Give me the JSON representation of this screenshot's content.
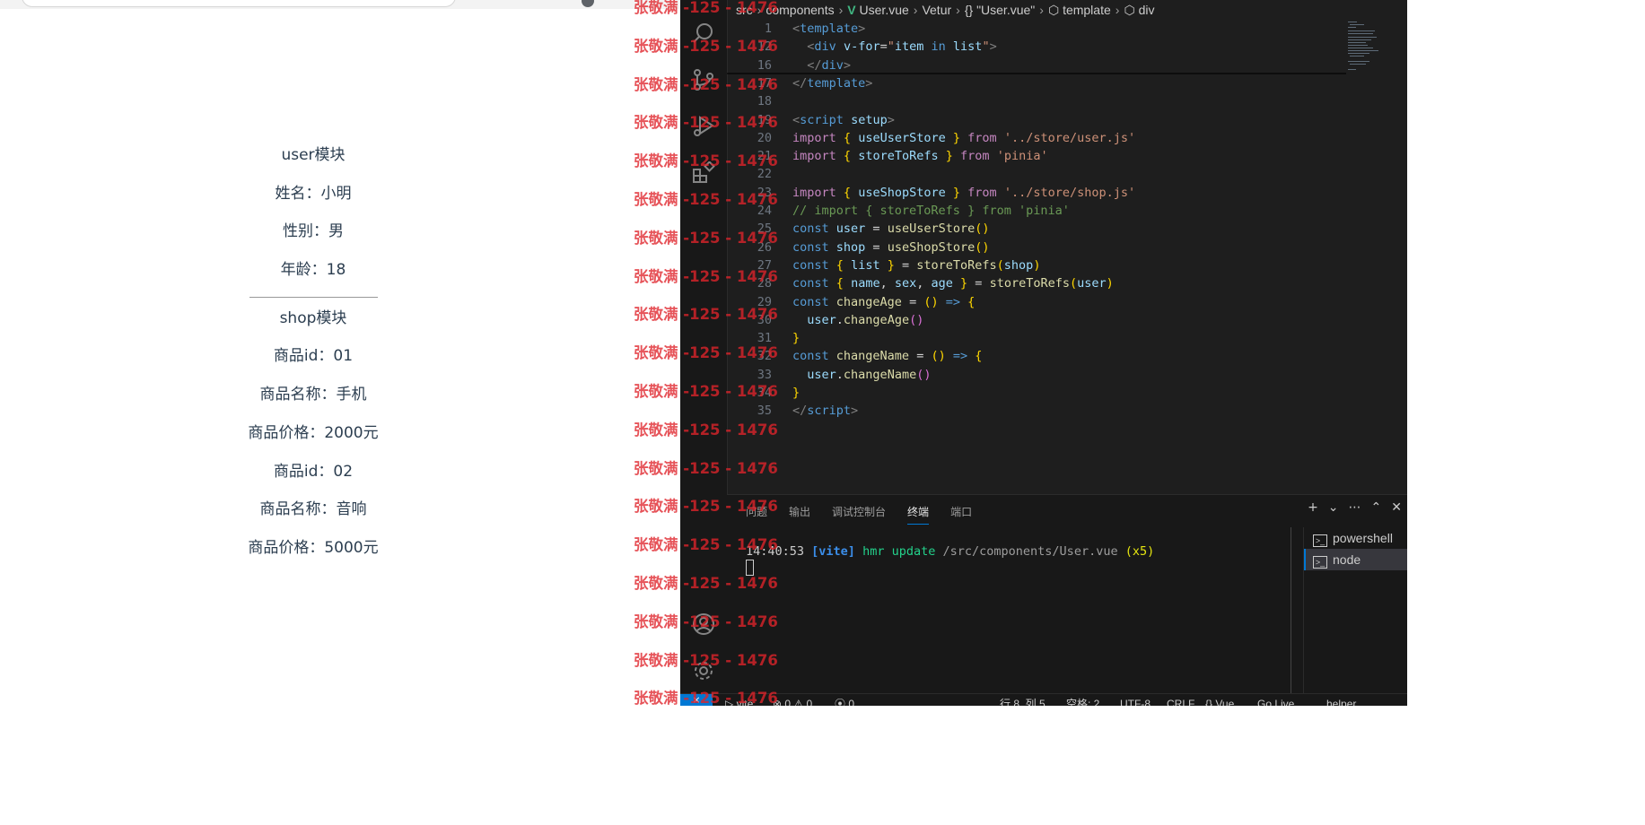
{
  "browser": {
    "sections": [
      {
        "title": "user模块",
        "lines": [
          "姓名：小明",
          "性别：男",
          "年龄：18"
        ]
      },
      {
        "title": "shop模块",
        "lines": [
          "商品id：01",
          "商品名称：手机",
          "商品价格：2000元",
          "商品id：02",
          "商品名称：音响",
          "商品价格：5000元"
        ]
      }
    ]
  },
  "vscode": {
    "breadcrumb": [
      "src",
      "components",
      "User.vue",
      "Vetur",
      "{} \"User.vue\"",
      "template",
      "div"
    ],
    "activity_icons": [
      "search-icon",
      "source-control-icon",
      "run-debug-icon",
      "extensions-icon",
      "account-icon",
      "settings-gear-icon"
    ],
    "code_lines": [
      {
        "n": "1",
        "tokens": [
          [
            "t-tag",
            "<"
          ],
          [
            "t-name",
            "template"
          ],
          [
            "t-tag",
            ">"
          ]
        ]
      },
      {
        "n": "12",
        "tokens": [
          [
            "t-op",
            "  "
          ],
          [
            "t-tag",
            "<"
          ],
          [
            "t-name",
            "div"
          ],
          [
            "t-op",
            " "
          ],
          [
            "t-attr",
            "v-for"
          ],
          [
            "t-op",
            "="
          ],
          [
            "t-str",
            "\""
          ],
          [
            "t-var",
            "item"
          ],
          [
            "t-op",
            " "
          ],
          [
            "t-const",
            "in"
          ],
          [
            "t-op",
            " "
          ],
          [
            "t-var",
            "list"
          ],
          [
            "t-str",
            "\""
          ],
          [
            "t-tag",
            ">"
          ]
        ]
      },
      {
        "n": "16",
        "tokens": [
          [
            "t-op",
            "  "
          ],
          [
            "t-tag",
            "</"
          ],
          [
            "t-name",
            "div"
          ],
          [
            "t-tag",
            ">"
          ]
        ]
      },
      {
        "n": "17",
        "tokens": [
          [
            "t-tag",
            "</"
          ],
          [
            "t-name",
            "template"
          ],
          [
            "t-tag",
            ">"
          ]
        ]
      },
      {
        "n": "18",
        "tokens": []
      },
      {
        "n": "19",
        "tokens": [
          [
            "t-tag",
            "<"
          ],
          [
            "t-name",
            "script"
          ],
          [
            "t-op",
            " "
          ],
          [
            "t-attr",
            "setup"
          ],
          [
            "t-tag",
            ">"
          ]
        ]
      },
      {
        "n": "20",
        "tokens": [
          [
            "t-kw",
            "import"
          ],
          [
            "t-op",
            " "
          ],
          [
            "t-b1",
            "{"
          ],
          [
            "t-op",
            " "
          ],
          [
            "t-var",
            "useUserStore"
          ],
          [
            "t-op",
            " "
          ],
          [
            "t-b1",
            "}"
          ],
          [
            "t-op",
            " "
          ],
          [
            "t-kw",
            "from"
          ],
          [
            "t-op",
            " "
          ],
          [
            "t-str",
            "'../store/user.js'"
          ]
        ]
      },
      {
        "n": "21",
        "tokens": [
          [
            "t-kw",
            "import"
          ],
          [
            "t-op",
            " "
          ],
          [
            "t-b1",
            "{"
          ],
          [
            "t-op",
            " "
          ],
          [
            "t-var",
            "storeToRefs"
          ],
          [
            "t-op",
            " "
          ],
          [
            "t-b1",
            "}"
          ],
          [
            "t-op",
            " "
          ],
          [
            "t-kw",
            "from"
          ],
          [
            "t-op",
            " "
          ],
          [
            "t-str",
            "'pinia'"
          ]
        ]
      },
      {
        "n": "22",
        "tokens": []
      },
      {
        "n": "23",
        "tokens": [
          [
            "t-kw",
            "import"
          ],
          [
            "t-op",
            " "
          ],
          [
            "t-b1",
            "{"
          ],
          [
            "t-op",
            " "
          ],
          [
            "t-var",
            "useShopStore"
          ],
          [
            "t-op",
            " "
          ],
          [
            "t-b1",
            "}"
          ],
          [
            "t-op",
            " "
          ],
          [
            "t-kw",
            "from"
          ],
          [
            "t-op",
            " "
          ],
          [
            "t-str",
            "'../store/shop.js'"
          ]
        ]
      },
      {
        "n": "24",
        "tokens": [
          [
            "t-cm",
            "// import { storeToRefs } from 'pinia'"
          ]
        ]
      },
      {
        "n": "25",
        "tokens": [
          [
            "t-const",
            "const"
          ],
          [
            "t-op",
            " "
          ],
          [
            "t-var",
            "user"
          ],
          [
            "t-op",
            " = "
          ],
          [
            "t-fn",
            "useUserStore"
          ],
          [
            "t-b1",
            "()"
          ]
        ]
      },
      {
        "n": "26",
        "tokens": [
          [
            "t-const",
            "const"
          ],
          [
            "t-op",
            " "
          ],
          [
            "t-var",
            "shop"
          ],
          [
            "t-op",
            " = "
          ],
          [
            "t-fn",
            "useShopStore"
          ],
          [
            "t-b1",
            "()"
          ]
        ]
      },
      {
        "n": "27",
        "tokens": [
          [
            "t-const",
            "const"
          ],
          [
            "t-op",
            " "
          ],
          [
            "t-b1",
            "{"
          ],
          [
            "t-op",
            " "
          ],
          [
            "t-var",
            "list"
          ],
          [
            "t-op",
            " "
          ],
          [
            "t-b1",
            "}"
          ],
          [
            "t-op",
            " = "
          ],
          [
            "t-fn",
            "storeToRefs"
          ],
          [
            "t-b1",
            "("
          ],
          [
            "t-var",
            "shop"
          ],
          [
            "t-b1",
            ")"
          ]
        ]
      },
      {
        "n": "28",
        "tokens": [
          [
            "t-const",
            "const"
          ],
          [
            "t-op",
            " "
          ],
          [
            "t-b1",
            "{"
          ],
          [
            "t-op",
            " "
          ],
          [
            "t-var",
            "name"
          ],
          [
            "t-op",
            ", "
          ],
          [
            "t-var",
            "sex"
          ],
          [
            "t-op",
            ", "
          ],
          [
            "t-var",
            "age"
          ],
          [
            "t-op",
            " "
          ],
          [
            "t-b1",
            "}"
          ],
          [
            "t-op",
            " = "
          ],
          [
            "t-fn",
            "storeToRefs"
          ],
          [
            "t-b1",
            "("
          ],
          [
            "t-var",
            "user"
          ],
          [
            "t-b1",
            ")"
          ]
        ]
      },
      {
        "n": "29",
        "tokens": [
          [
            "t-const",
            "const"
          ],
          [
            "t-op",
            " "
          ],
          [
            "t-fn",
            "changeAge"
          ],
          [
            "t-op",
            " = "
          ],
          [
            "t-b1",
            "()"
          ],
          [
            "t-op",
            " "
          ],
          [
            "t-const",
            "=>"
          ],
          [
            "t-op",
            " "
          ],
          [
            "t-b1",
            "{"
          ]
        ]
      },
      {
        "n": "30",
        "tokens": [
          [
            "t-op",
            "  "
          ],
          [
            "t-var",
            "user"
          ],
          [
            "t-op",
            "."
          ],
          [
            "t-fn",
            "changeAge"
          ],
          [
            "t-b2",
            "()"
          ]
        ]
      },
      {
        "n": "31",
        "tokens": [
          [
            "t-b1",
            "}"
          ]
        ]
      },
      {
        "n": "32",
        "tokens": [
          [
            "t-const",
            "const"
          ],
          [
            "t-op",
            " "
          ],
          [
            "t-fn",
            "changeName"
          ],
          [
            "t-op",
            " = "
          ],
          [
            "t-b1",
            "()"
          ],
          [
            "t-op",
            " "
          ],
          [
            "t-const",
            "=>"
          ],
          [
            "t-op",
            " "
          ],
          [
            "t-b1",
            "{"
          ]
        ]
      },
      {
        "n": "33",
        "tokens": [
          [
            "t-op",
            "  "
          ],
          [
            "t-var",
            "user"
          ],
          [
            "t-op",
            "."
          ],
          [
            "t-fn",
            "changeName"
          ],
          [
            "t-b2",
            "()"
          ]
        ]
      },
      {
        "n": "34",
        "tokens": [
          [
            "t-b1",
            "}"
          ]
        ]
      },
      {
        "n": "35",
        "tokens": [
          [
            "t-tag",
            "</"
          ],
          [
            "t-name",
            "script"
          ],
          [
            "t-tag",
            ">"
          ]
        ]
      }
    ],
    "panel": {
      "tabs": [
        "问题",
        "输出",
        "调试控制台",
        "终端",
        "端口"
      ],
      "active_tab": "终端",
      "actions": [
        "+",
        "⌄",
        "⋯",
        "⌃",
        "✕"
      ],
      "terminal": {
        "time": "14:40:53",
        "tag": "[vite]",
        "msg": "hmr update",
        "path": "/src/components/User.vue",
        "count": "(x5)"
      },
      "terminals": [
        {
          "label": "powershell",
          "active": false
        },
        {
          "label": "node",
          "active": true
        }
      ]
    },
    "statusbar": {
      "remote_glyph": "⨯",
      "items": [
        "▷ vite",
        "⊗ 0 ⚠ 0",
        "⦿ 0",
        "行 8, 列 5",
        "空格: 2",
        "UTF-8",
        "CRLF",
        "{} Vue",
        "Go Live",
        "helper"
      ]
    }
  },
  "watermark": {
    "text": "张敬满 -125 - 1476",
    "rows": 19
  },
  "colors": {
    "accent": "#0078d4",
    "watermark": "#e0242b",
    "editor_bg": "#1e1e1e",
    "vue_green": "#41b883"
  }
}
